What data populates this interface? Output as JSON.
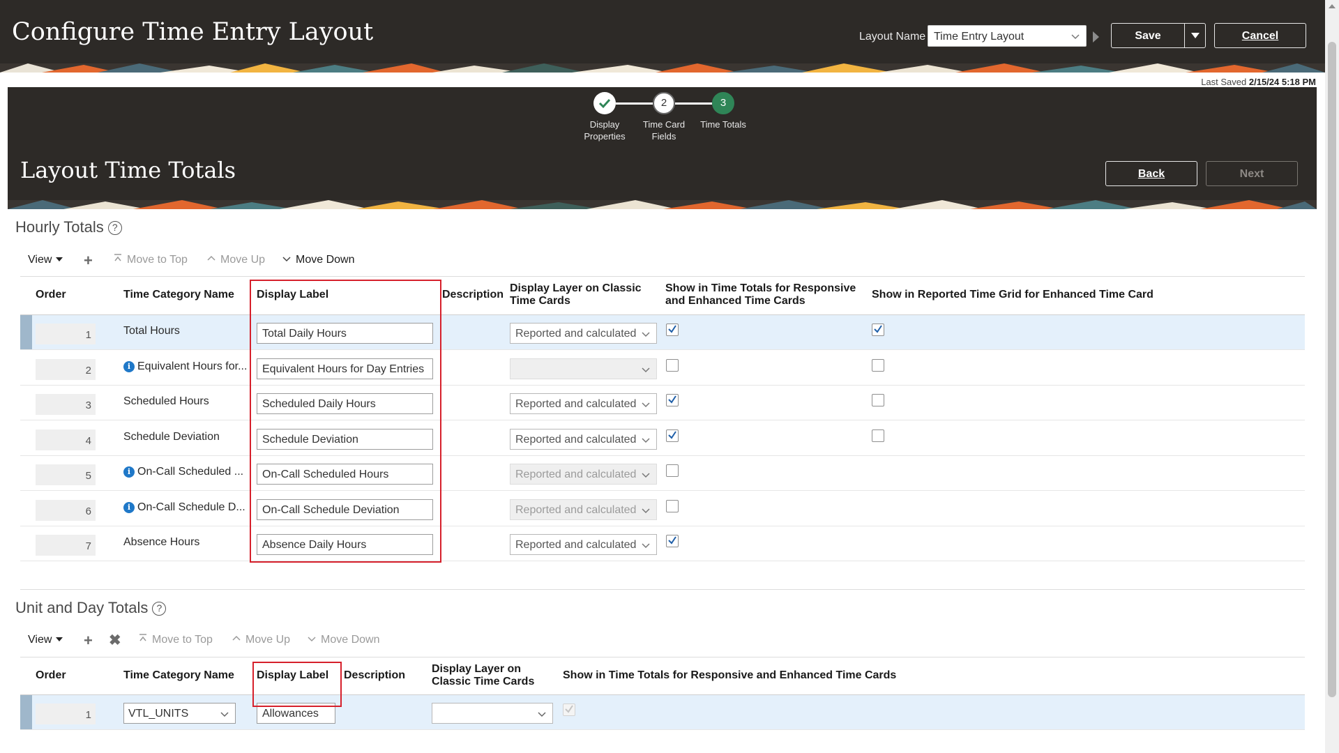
{
  "header": {
    "title": "Configure Time Entry Layout",
    "layout_name_label": "Layout Name",
    "layout_name_value": "Time Entry Layout",
    "save_label": "Save",
    "cancel_label": "Cancel"
  },
  "last_saved": {
    "label": "Last Saved",
    "value": "2/15/24 5:18 PM"
  },
  "train": {
    "steps": [
      {
        "number": "",
        "label_line1": "Display",
        "label_line2": "Properties",
        "state": "complete"
      },
      {
        "number": "2",
        "label_line1": "Time Card",
        "label_line2": "Fields",
        "state": "visited"
      },
      {
        "number": "3",
        "label_line1": "Time Totals",
        "label_line2": "",
        "state": "current"
      }
    ]
  },
  "page": {
    "heading": "Layout Time Totals",
    "back_label": "Back",
    "next_label": "Next"
  },
  "hourly": {
    "title": "Hourly Totals",
    "toolbar": {
      "view": "View",
      "move_top": "Move to Top",
      "move_up": "Move Up",
      "move_down": "Move Down"
    },
    "columns": {
      "order": "Order",
      "category": "Time Category Name",
      "display_label": "Display Label",
      "description": "Description",
      "layer_line1": "Display Layer on Classic",
      "layer_line2": "Time Cards",
      "totals_line1": "Show in Time Totals for Responsive",
      "totals_line2": "and Enhanced Time Cards",
      "grid": "Show in Reported Time Grid for Enhanced Time Card"
    },
    "rows": [
      {
        "order": "1",
        "category": "Total Hours",
        "info": false,
        "label": "Total Daily Hours",
        "layer": "Reported and calculated",
        "layer_disabled": false,
        "show_totals": true,
        "show_grid": true,
        "selected": true
      },
      {
        "order": "2",
        "category": "Equivalent Hours for...",
        "info": true,
        "label": "Equivalent Hours for Day Entries",
        "layer": "",
        "layer_disabled": true,
        "show_totals": false,
        "show_grid": false,
        "selected": false
      },
      {
        "order": "3",
        "category": "Scheduled Hours",
        "info": false,
        "label": "Scheduled Daily Hours",
        "layer": "Reported and calculated",
        "layer_disabled": false,
        "show_totals": true,
        "show_grid": false,
        "selected": false
      },
      {
        "order": "4",
        "category": "Schedule Deviation",
        "info": false,
        "label": "Schedule Deviation",
        "layer": "Reported and calculated",
        "layer_disabled": false,
        "show_totals": true,
        "show_grid": false,
        "selected": false
      },
      {
        "order": "5",
        "category": "On-Call Scheduled ...",
        "info": true,
        "label": "On-Call Scheduled Hours",
        "layer": "Reported and calculated",
        "layer_disabled": true,
        "show_totals": false,
        "show_grid": null,
        "selected": false
      },
      {
        "order": "6",
        "category": "On-Call Schedule D...",
        "info": true,
        "label": "On-Call Schedule Deviation",
        "layer": "Reported and calculated",
        "layer_disabled": true,
        "show_totals": false,
        "show_grid": null,
        "selected": false
      },
      {
        "order": "7",
        "category": "Absence Hours",
        "info": false,
        "label": "Absence Daily Hours",
        "layer": "Reported and calculated",
        "layer_disabled": false,
        "show_totals": true,
        "show_grid": null,
        "selected": false
      }
    ]
  },
  "unit": {
    "title": "Unit and Day Totals",
    "toolbar": {
      "view": "View",
      "move_top": "Move to Top",
      "move_up": "Move Up",
      "move_down": "Move Down"
    },
    "columns": {
      "order": "Order",
      "category": "Time Category Name",
      "display_label": "Display Label",
      "description": "Description",
      "layer_line1": "Display Layer on",
      "layer_line2": "Classic Time Cards",
      "totals": "Show in Time Totals for Responsive and Enhanced Time Cards"
    },
    "rows": [
      {
        "order": "1",
        "category": "VTL_UNITS",
        "label": "Allowances",
        "layer": "",
        "show_totals": true,
        "totals_disabled": true
      }
    ]
  },
  "colors": {
    "header_bg": "#2d2a27",
    "selected_row": "#e4f0fb",
    "highlight_box": "#d6202b",
    "checkbox_check": "#1f5fa8",
    "current_step": "#2f8557"
  }
}
